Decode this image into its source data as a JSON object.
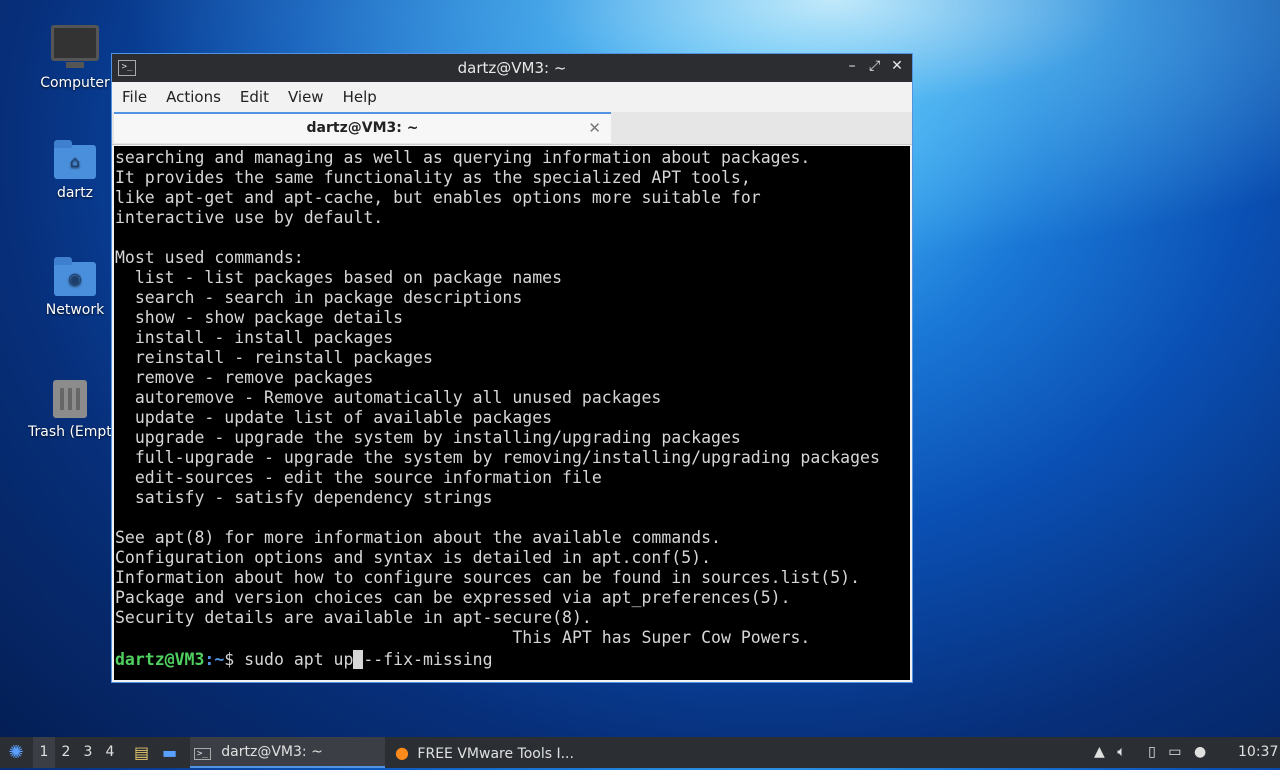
{
  "desktop": {
    "icons": [
      {
        "label": "Computer"
      },
      {
        "label": "dartz"
      },
      {
        "label": "Network"
      },
      {
        "label": "Trash (Empty)"
      }
    ]
  },
  "window": {
    "title": "dartz@VM3: ~",
    "menu": [
      "File",
      "Actions",
      "Edit",
      "View",
      "Help"
    ],
    "tab_label": "dartz@VM3: ~",
    "terminal_lines": [
      "searching and managing as well as querying information about packages.",
      "It provides the same functionality as the specialized APT tools,",
      "like apt-get and apt-cache, but enables options more suitable for",
      "interactive use by default.",
      "",
      "Most used commands:",
      "  list - list packages based on package names",
      "  search - search in package descriptions",
      "  show - show package details",
      "  install - install packages",
      "  reinstall - reinstall packages",
      "  remove - remove packages",
      "  autoremove - Remove automatically all unused packages",
      "  update - update list of available packages",
      "  upgrade - upgrade the system by installing/upgrading packages",
      "  full-upgrade - upgrade the system by removing/installing/upgrading packages",
      "  edit-sources - edit the source information file",
      "  satisfy - satisfy dependency strings",
      "",
      "See apt(8) for more information about the available commands.",
      "Configuration options and syntax is detailed in apt.conf(5).",
      "Information about how to configure sources can be found in sources.list(5).",
      "Package and version choices can be expressed via apt_preferences(5).",
      "Security details are available in apt-secure(8).",
      "                                        This APT has Super Cow Powers."
    ],
    "prompt": {
      "user_host": "dartz@VM3",
      "path": ":~",
      "symbol": "$ ",
      "command_before_cursor": "sudo apt up",
      "cursor_char": " ",
      "command_after_cursor": "--fix-missing"
    }
  },
  "taskbar": {
    "workspaces": [
      "1",
      "2",
      "3",
      "4"
    ],
    "tasks": [
      {
        "label": "dartz@VM3: ~"
      },
      {
        "label": "FREE VMware Tools I..."
      }
    ],
    "clock": "10:37"
  },
  "colors": {
    "accent": "#5294e2",
    "prompt_user": "#4fd05f",
    "terminal_bg": "#000000"
  }
}
